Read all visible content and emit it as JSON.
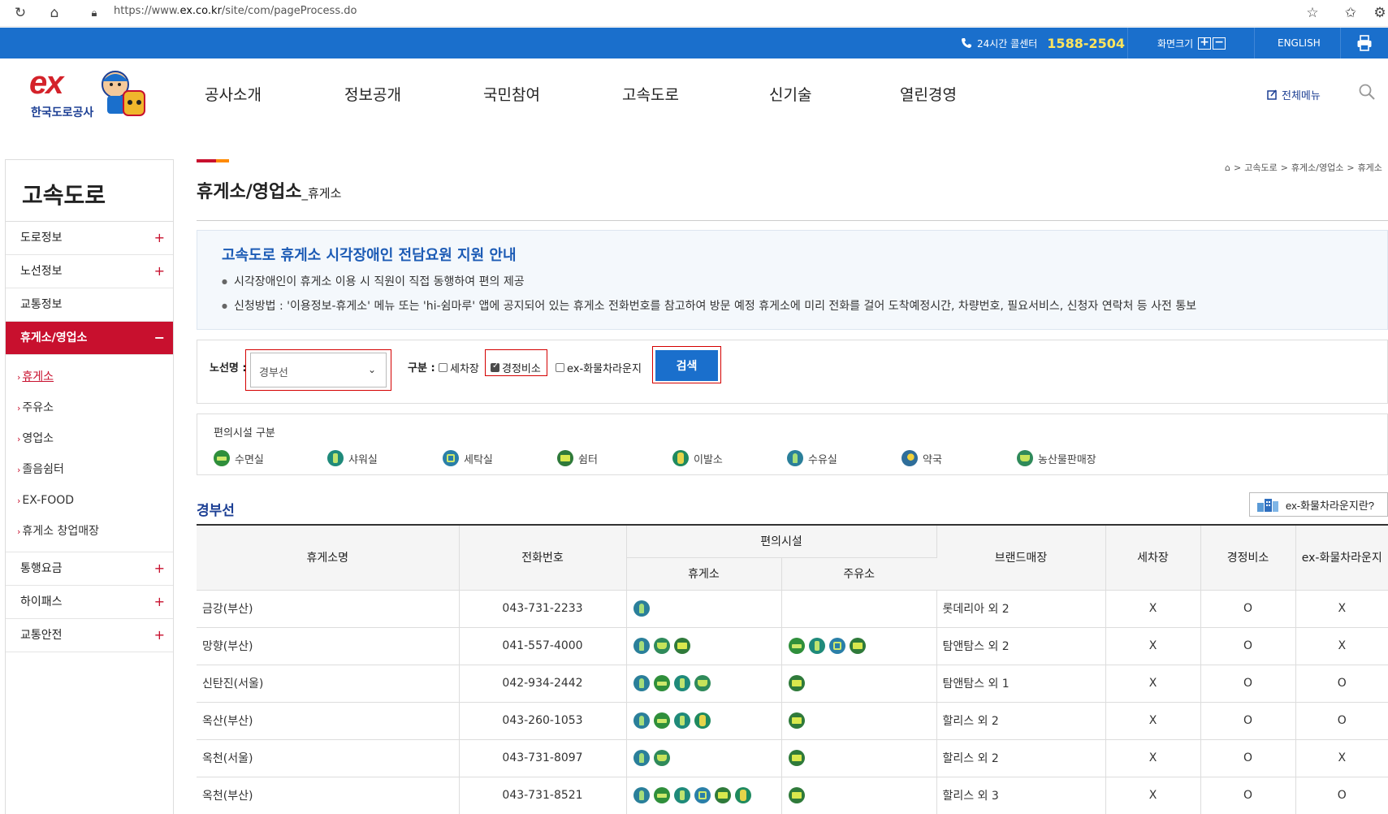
{
  "browser": {
    "url_prefix": "https://www.",
    "url_domain": "ex.co.kr",
    "url_path": "/site/com/pageProcess.do"
  },
  "utility": {
    "center_label": "24시간 콜센터",
    "center_number": "1588-2504",
    "zoom_label": "화면크기",
    "english": "ENGLISH"
  },
  "header": {
    "logo_text": "ex",
    "logo_sub": "한국도로공사",
    "nav": [
      "공사소개",
      "정보공개",
      "국민참여",
      "고속도로",
      "신기술",
      "열린경영"
    ],
    "all_menu": "전체메뉴"
  },
  "lnb": {
    "title": "고속도로",
    "menus": [
      {
        "label": "도로정보",
        "sign": "+"
      },
      {
        "label": "노선정보",
        "sign": "+"
      },
      {
        "label": "교통정보",
        "sign": ""
      },
      {
        "label": "휴게소/영업소",
        "sign": "−"
      }
    ],
    "subs": [
      "휴게소",
      "주유소",
      "영업소",
      "졸음쉼터",
      "EX-FOOD",
      "휴게소 창업매장"
    ],
    "menus_after": [
      {
        "label": "통행요금",
        "sign": "+"
      },
      {
        "label": "하이패스",
        "sign": "+"
      },
      {
        "label": "교통안전",
        "sign": "+"
      }
    ]
  },
  "page": {
    "title": "휴게소/영업소",
    "title_small": "_휴게소",
    "breadcrumb": [
      "고속도로",
      "휴게소/영업소",
      "휴게소"
    ]
  },
  "notice": {
    "heading": "고속도로 휴게소 시각장애인 전담요원 지원 안내",
    "items": [
      "시각장애인이 휴게소 이용 시 직원이 직접 동행하여 편의 제공",
      "신청방법 : '이용정보-휴게소' 메뉴 또는 'hi-쉼마루' 앱에 공지되어 있는 휴게소 전화번호를 참고하여 방문 예정 휴게소에 미리 전화를 걸어 도착예정시간, 차량번호, 필요서비스, 신청자 연락처 등 사전 통보"
    ]
  },
  "search": {
    "route_label": "노선명 :",
    "route_value": "경부선",
    "type_label": "구분 :",
    "checks": [
      {
        "label": "세차장",
        "checked": false
      },
      {
        "label": "경정비소",
        "checked": true
      },
      {
        "label": "ex-화물차라운지",
        "checked": false
      }
    ],
    "button": "검색"
  },
  "facility": {
    "caption": "편의시설 구분",
    "items": [
      {
        "icon": "sleep",
        "label": "수면실"
      },
      {
        "icon": "shower",
        "label": "샤워실"
      },
      {
        "icon": "laundry",
        "label": "세탁실"
      },
      {
        "icon": "shelter",
        "label": "쉼터"
      },
      {
        "icon": "barber",
        "label": "이발소"
      },
      {
        "icon": "nursing",
        "label": "수유실"
      },
      {
        "icon": "pharmacy",
        "label": "약국"
      },
      {
        "icon": "market",
        "label": "농산물판매장"
      }
    ]
  },
  "list": {
    "section": "경부선",
    "truck_button": "ex-화물차라운지란?",
    "headers": {
      "name": "휴게소명",
      "phone": "전화번호",
      "facilities": "편의시설",
      "rest": "휴게소",
      "gas": "주유소",
      "brand": "브랜드매장",
      "wash": "세차장",
      "repair": "경정비소",
      "truck": "ex-화물차라운지"
    },
    "rows": [
      {
        "name": "금강(부산)",
        "phone": "043-731-2233",
        "rest_icons": [
          "nursing"
        ],
        "gas_icons": [],
        "brand": "롯데리아 외 2",
        "wash": "X",
        "repair": "O",
        "truck": "X"
      },
      {
        "name": "망향(부산)",
        "phone": "041-557-4000",
        "rest_icons": [
          "nursing",
          "market",
          "shelter"
        ],
        "gas_icons": [
          "sleep",
          "shower",
          "laundry",
          "shelter"
        ],
        "brand": "탐앤탐스 외 2",
        "wash": "X",
        "repair": "O",
        "truck": "X"
      },
      {
        "name": "신탄진(서울)",
        "phone": "042-934-2442",
        "rest_icons": [
          "nursing",
          "sleep",
          "shower",
          "market"
        ],
        "gas_icons": [
          "shelter"
        ],
        "brand": "탐앤탐스 외 1",
        "wash": "X",
        "repair": "O",
        "truck": "O"
      },
      {
        "name": "옥산(부산)",
        "phone": "043-260-1053",
        "rest_icons": [
          "nursing",
          "sleep",
          "shower",
          "barber"
        ],
        "gas_icons": [
          "shelter"
        ],
        "brand": "할리스 외 2",
        "wash": "X",
        "repair": "O",
        "truck": "O"
      },
      {
        "name": "옥천(서울)",
        "phone": "043-731-8097",
        "rest_icons": [
          "nursing",
          "market"
        ],
        "gas_icons": [
          "shelter"
        ],
        "brand": "할리스 외 2",
        "wash": "X",
        "repair": "O",
        "truck": "X"
      },
      {
        "name": "옥천(부산)",
        "phone": "043-731-8521",
        "rest_icons": [
          "nursing",
          "sleep",
          "shower",
          "laundry",
          "shelter",
          "barber"
        ],
        "gas_icons": [
          "shelter"
        ],
        "brand": "할리스 외 3",
        "wash": "X",
        "repair": "O",
        "truck": "O"
      }
    ]
  }
}
